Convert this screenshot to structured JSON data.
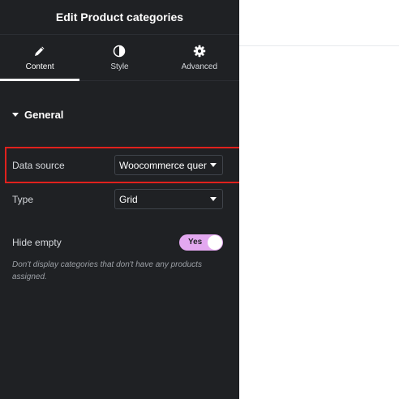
{
  "header": {
    "title": "Edit Product categories"
  },
  "tabs": [
    {
      "label": "Content",
      "icon": "pencil-icon",
      "active": true
    },
    {
      "label": "Style",
      "icon": "contrast-icon",
      "active": false
    },
    {
      "label": "Advanced",
      "icon": "gear-icon",
      "active": false
    }
  ],
  "section": {
    "title": "General",
    "expanded": true
  },
  "controls": {
    "data_source": {
      "label": "Data source",
      "value": "Woocommerce query"
    },
    "type": {
      "label": "Type",
      "value": "Grid"
    },
    "hide_empty": {
      "label": "Hide empty",
      "toggle_label": "Yes",
      "on": true,
      "help": "Don't display categories that don't have any products assigned."
    }
  },
  "colors": {
    "panel_bg": "#1f2124",
    "accent_toggle": "#e3a8f0",
    "highlight_border": "#e0211d"
  }
}
